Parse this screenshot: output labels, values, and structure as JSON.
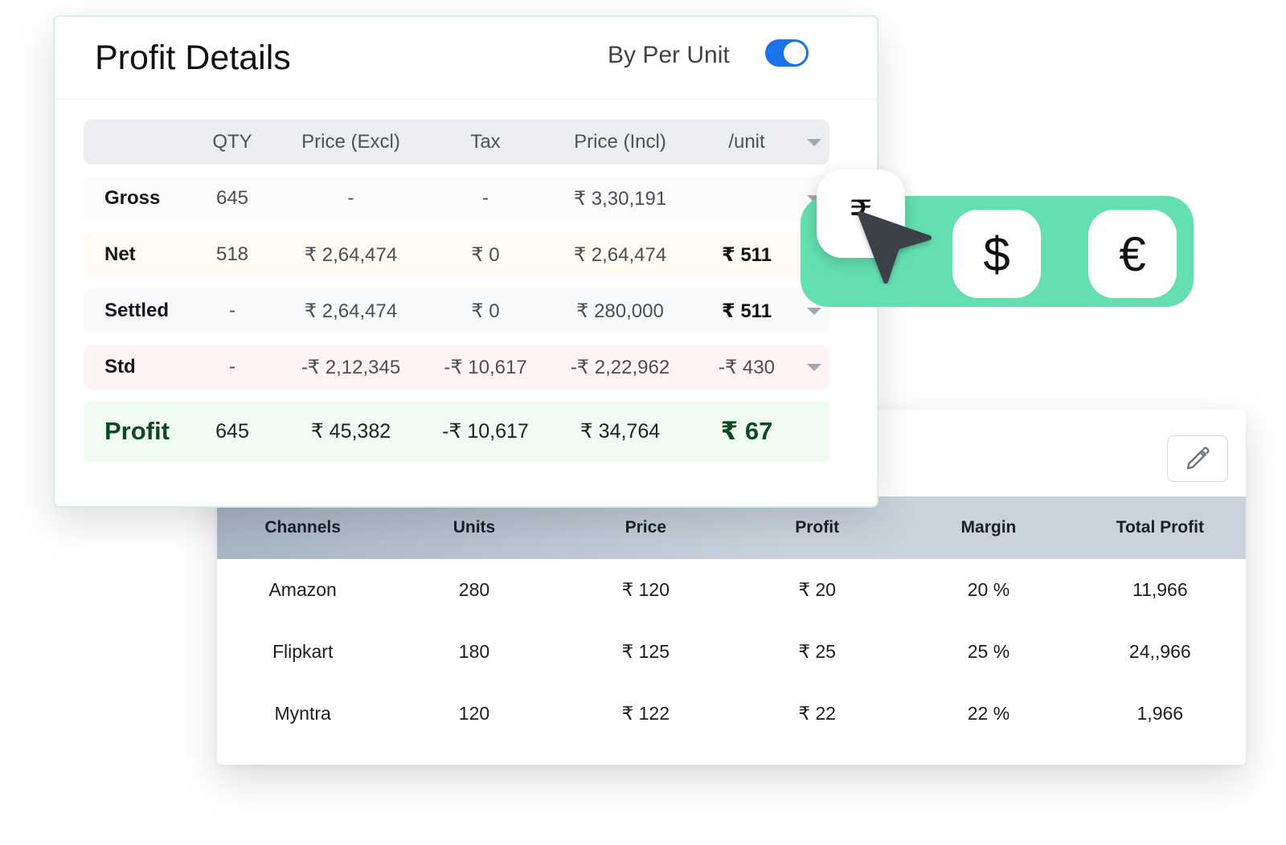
{
  "profit_details": {
    "title": "Profit Details",
    "toggle_label": "By Per Unit",
    "toggle_on": true,
    "columns": [
      "",
      "QTY",
      "Price (Excl)",
      "Tax",
      "Price (Incl)",
      "/unit"
    ],
    "rows": [
      {
        "label": "Gross",
        "qty": "645",
        "price_excl": "-",
        "tax": "-",
        "price_incl": "₹ 3,30,191",
        "per_unit": ""
      },
      {
        "label": "Net",
        "qty": "518",
        "price_excl": "₹ 2,64,474",
        "tax": "₹ 0",
        "price_incl": "₹ 2,64,474",
        "per_unit": "₹ 511"
      },
      {
        "label": "Settled",
        "qty": "-",
        "price_excl": "₹ 2,64,474",
        "tax": "₹ 0",
        "price_incl": "₹ 280,000",
        "per_unit": "₹ 511"
      },
      {
        "label": "Std",
        "qty": "-",
        "price_excl": "-₹ 2,12,345",
        "tax": "-₹ 10,617",
        "price_incl": "-₹ 2,22,962",
        "per_unit": "-₹ 430"
      }
    ],
    "profit_row": {
      "label": "Profit",
      "qty": "645",
      "price_excl": "₹ 45,382",
      "tax": "-₹ 10,617",
      "price_incl": "₹ 34,764",
      "per_unit": "₹ 67"
    }
  },
  "currency_switcher": {
    "options": [
      "₹",
      "$",
      "€"
    ],
    "selected": "₹",
    "accent_color": "#64e0b0"
  },
  "channels_table": {
    "edit_icon": "pencil-icon",
    "columns": [
      "Channels",
      "Units",
      "Price",
      "Profit",
      "Margin",
      "Total Profit"
    ],
    "rows": [
      {
        "channel": "Amazon",
        "units": "280",
        "price": "₹ 120",
        "profit": "₹ 20",
        "margin": "20 %",
        "total_profit": "11,966"
      },
      {
        "channel": "Flipkart",
        "units": "180",
        "price": "₹ 125",
        "profit": "₹ 25",
        "margin": "25 %",
        "total_profit": "24,,966"
      },
      {
        "channel": "Myntra",
        "units": "120",
        "price": "₹ 122",
        "profit": "₹ 22",
        "margin": "22 %",
        "total_profit": "1,966"
      }
    ]
  },
  "colors": {
    "toggle_blue": "#1a73e8",
    "profit_green": "#0f4a1e",
    "header_gray": "#eceef1"
  }
}
